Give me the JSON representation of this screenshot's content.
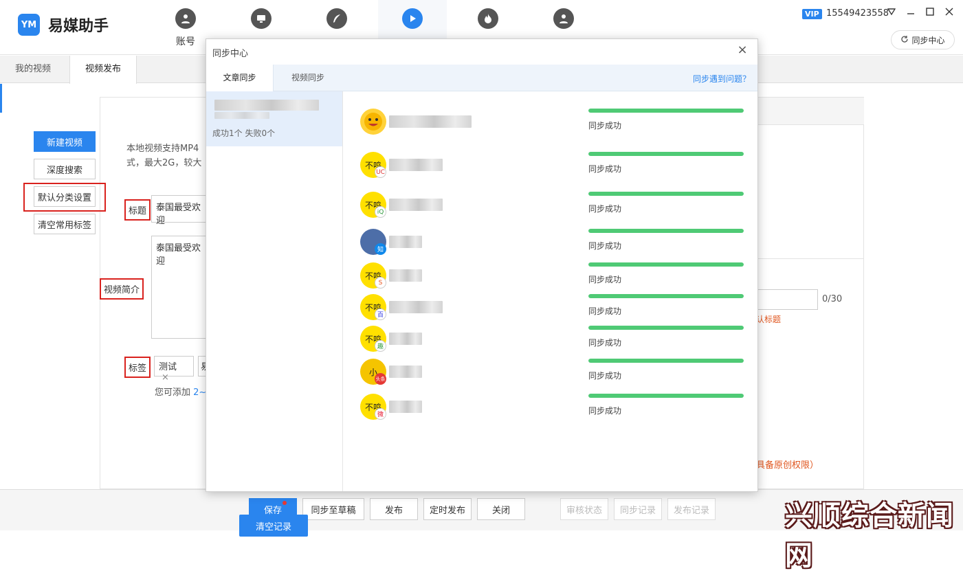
{
  "app": {
    "logo_text": "YM",
    "title": "易媒助手",
    "vip": "VIP",
    "account": "15549423558",
    "sync_center_button": "同步中心"
  },
  "nav": [
    {
      "label": "账号",
      "icon": "user-icon",
      "active": false
    },
    {
      "label": "",
      "icon": "monitor-icon",
      "active": false
    },
    {
      "label": "",
      "icon": "feather-icon",
      "active": false
    },
    {
      "label": "",
      "icon": "play-icon",
      "active": true
    },
    {
      "label": "",
      "icon": "flame-icon",
      "active": false
    },
    {
      "label": "",
      "icon": "team-icon",
      "active": false
    }
  ],
  "subtabs": {
    "my_videos": "我的视频",
    "publish": "视频发布"
  },
  "sidebar": {
    "new_video": "新建视频",
    "deep_search": "深度搜索",
    "default_category": "默认分类设置",
    "clear_tags": "清空常用标签"
  },
  "form": {
    "upload_hint_line1": "本地视频支持MP4",
    "upload_hint_line2": "式，最大2G，较大",
    "title_label": "标题",
    "title_value": "泰国最受欢迎",
    "intro_label": "视频简介",
    "intro_value": "泰国最受欢迎",
    "tags_label": "标签",
    "tag1": "测试",
    "tag_close": "×",
    "tag2_partial": "易",
    "tags_hint": "您可添加",
    "tags_hint_num": "2~",
    "counter": "0/30",
    "red_hint1": "认标题",
    "red_hint2": "具备原创权限）"
  },
  "bottom": {
    "save": "保存",
    "sync_draft": "同步至草稿",
    "publish": "发布",
    "scheduled": "定时发布",
    "close": "关闭",
    "review_status": "审核状态",
    "sync_records": "同步记录",
    "publish_records": "发布记录"
  },
  "watermark": "兴顺综合新闻网",
  "modal": {
    "title": "同步中心",
    "close": "×",
    "tab_article": "文章同步",
    "tab_video": "视频同步",
    "help_link": "同步遇到问题？",
    "record_stats": "成功1个 失败0个",
    "clear_button": "清空记录",
    "accounts": [
      {
        "avatar_text": "",
        "badge": "",
        "status": "同步成功",
        "progress": 1.0
      },
      {
        "avatar_text": "不鸣",
        "badge": "UC",
        "status": "同步成功",
        "progress": 1.0
      },
      {
        "avatar_text": "不鸣",
        "badge": "iQ",
        "status": "同步成功",
        "progress": 1.0
      },
      {
        "avatar_text": "",
        "badge": "知",
        "status": "同步成功",
        "progress": 1.0
      },
      {
        "avatar_text": "不鸣",
        "badge": "S",
        "status": "同步成功",
        "progress": 1.0
      },
      {
        "avatar_text": "不鸣",
        "badge": "百",
        "status": "同步成功",
        "progress": 1.0
      },
      {
        "avatar_text": "不鸣",
        "badge": "趣",
        "status": "同步成功",
        "progress": 1.0
      },
      {
        "avatar_text": "小",
        "badge": "头条",
        "status": "同步成功",
        "progress": 1.0
      },
      {
        "avatar_text": "不鸣",
        "badge": "微",
        "status": "同步成功",
        "progress": 1.0
      }
    ]
  },
  "colors": {
    "accent": "#2a85ee",
    "success": "#4fca75",
    "highlight_red": "#d9211d"
  }
}
